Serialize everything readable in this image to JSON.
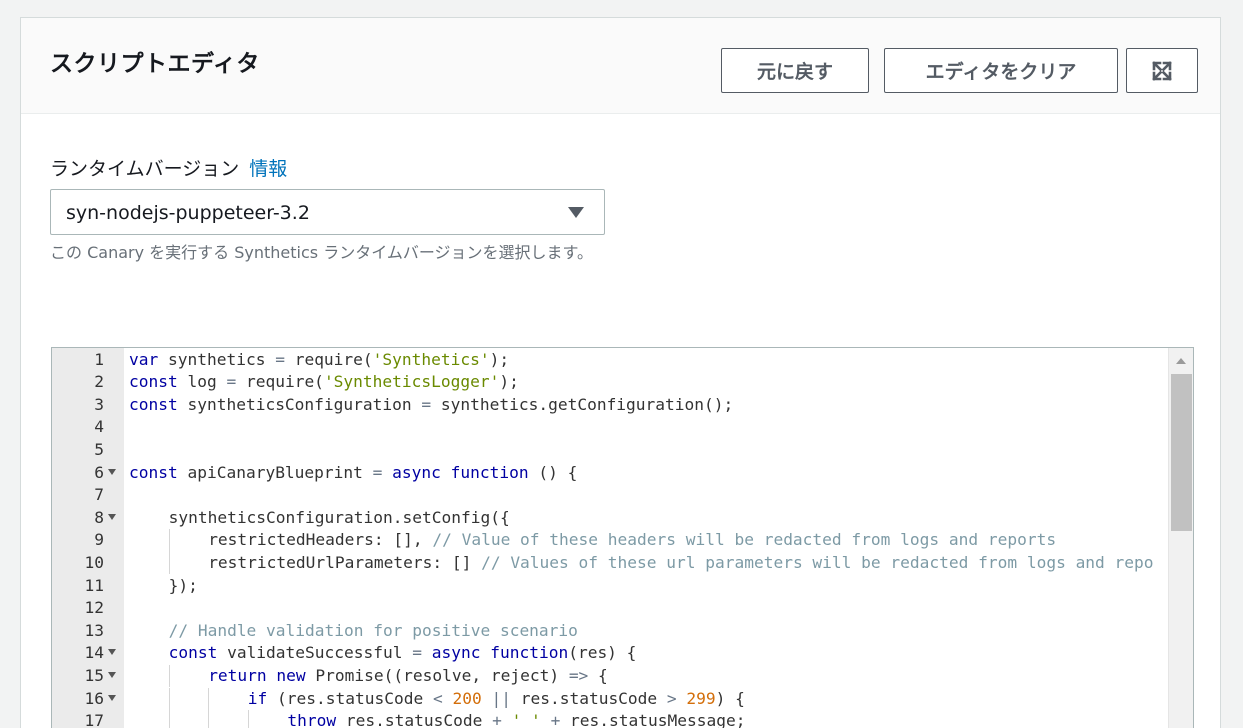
{
  "panel": {
    "title": "スクリプトエディタ",
    "undo_label": "元に戻す",
    "clear_label": "エディタをクリア",
    "fullscreen_icon": "expand-icon"
  },
  "runtime": {
    "label": "ランタイムバージョン",
    "info_link": "情報",
    "selected": "syn-nodejs-puppeteer-3.2",
    "help": "この Canary を実行する Synthetics ランタイムバージョンを選択します。"
  },
  "editor": {
    "lines": [
      {
        "num": "1",
        "fold": false,
        "indent": 0,
        "tokens": [
          {
            "t": "var",
            "c": "kw"
          },
          {
            "t": " synthetics "
          },
          {
            "t": "=",
            "c": "op"
          },
          {
            "t": " require("
          },
          {
            "t": "'Synthetics'",
            "c": "str"
          },
          {
            "t": ");"
          }
        ]
      },
      {
        "num": "2",
        "fold": false,
        "indent": 0,
        "tokens": [
          {
            "t": "const",
            "c": "kw"
          },
          {
            "t": " log "
          },
          {
            "t": "=",
            "c": "op"
          },
          {
            "t": " require("
          },
          {
            "t": "'SyntheticsLogger'",
            "c": "str"
          },
          {
            "t": ");"
          }
        ]
      },
      {
        "num": "3",
        "fold": false,
        "indent": 0,
        "tokens": [
          {
            "t": "const",
            "c": "kw"
          },
          {
            "t": " syntheticsConfiguration "
          },
          {
            "t": "=",
            "c": "op"
          },
          {
            "t": " synthetics.getConfiguration();"
          }
        ]
      },
      {
        "num": "4",
        "fold": false,
        "indent": 0,
        "tokens": []
      },
      {
        "num": "5",
        "fold": false,
        "indent": 0,
        "tokens": []
      },
      {
        "num": "6",
        "fold": true,
        "indent": 0,
        "tokens": [
          {
            "t": "const",
            "c": "kw"
          },
          {
            "t": " apiCanaryBlueprint "
          },
          {
            "t": "=",
            "c": "op"
          },
          {
            "t": " "
          },
          {
            "t": "async",
            "c": "kw"
          },
          {
            "t": " "
          },
          {
            "t": "function",
            "c": "kw"
          },
          {
            "t": " () {"
          }
        ]
      },
      {
        "num": "7",
        "fold": false,
        "indent": 0,
        "tokens": []
      },
      {
        "num": "8",
        "fold": true,
        "indent": 1,
        "tokens": [
          {
            "t": "syntheticsConfiguration.setConfig({"
          }
        ]
      },
      {
        "num": "9",
        "fold": false,
        "indent": 2,
        "tokens": [
          {
            "t": "restrictedHeaders: [], "
          },
          {
            "t": "// Value of these headers will be redacted from logs and reports",
            "c": "cm"
          }
        ]
      },
      {
        "num": "10",
        "fold": false,
        "indent": 2,
        "tokens": [
          {
            "t": "restrictedUrlParameters: [] "
          },
          {
            "t": "// Values of these url parameters will be redacted from logs and repo",
            "c": "cm"
          }
        ]
      },
      {
        "num": "11",
        "fold": false,
        "indent": 1,
        "tokens": [
          {
            "t": "});"
          }
        ]
      },
      {
        "num": "12",
        "fold": false,
        "indent": 0,
        "tokens": []
      },
      {
        "num": "13",
        "fold": false,
        "indent": 1,
        "tokens": [
          {
            "t": "// Handle validation for positive scenario",
            "c": "cm"
          }
        ]
      },
      {
        "num": "14",
        "fold": true,
        "indent": 1,
        "tokens": [
          {
            "t": "const",
            "c": "kw"
          },
          {
            "t": " validateSuccessful "
          },
          {
            "t": "=",
            "c": "op"
          },
          {
            "t": " "
          },
          {
            "t": "async",
            "c": "kw"
          },
          {
            "t": " "
          },
          {
            "t": "function",
            "c": "kw"
          },
          {
            "t": "(res) {"
          }
        ]
      },
      {
        "num": "15",
        "fold": true,
        "indent": 2,
        "tokens": [
          {
            "t": "return",
            "c": "kw"
          },
          {
            "t": " "
          },
          {
            "t": "new",
            "c": "kw"
          },
          {
            "t": " Promise((resolve, reject) "
          },
          {
            "t": "=>",
            "c": "op"
          },
          {
            "t": " {"
          }
        ]
      },
      {
        "num": "16",
        "fold": true,
        "indent": 3,
        "tokens": [
          {
            "t": "if",
            "c": "kw"
          },
          {
            "t": " (res.statusCode "
          },
          {
            "t": "<",
            "c": "op"
          },
          {
            "t": " "
          },
          {
            "t": "200",
            "c": "num"
          },
          {
            "t": " "
          },
          {
            "t": "||",
            "c": "op"
          },
          {
            "t": " res.statusCode "
          },
          {
            "t": ">",
            "c": "op"
          },
          {
            "t": " "
          },
          {
            "t": "299",
            "c": "num"
          },
          {
            "t": ") {"
          }
        ]
      },
      {
        "num": "17",
        "fold": false,
        "indent": 4,
        "tokens": [
          {
            "t": "throw",
            "c": "kw"
          },
          {
            "t": " res.statusCode "
          },
          {
            "t": "+",
            "c": "op"
          },
          {
            "t": " "
          },
          {
            "t": "' '",
            "c": "str"
          },
          {
            "t": " "
          },
          {
            "t": "+",
            "c": "op"
          },
          {
            "t": " res.statusMessage;"
          }
        ]
      }
    ]
  }
}
